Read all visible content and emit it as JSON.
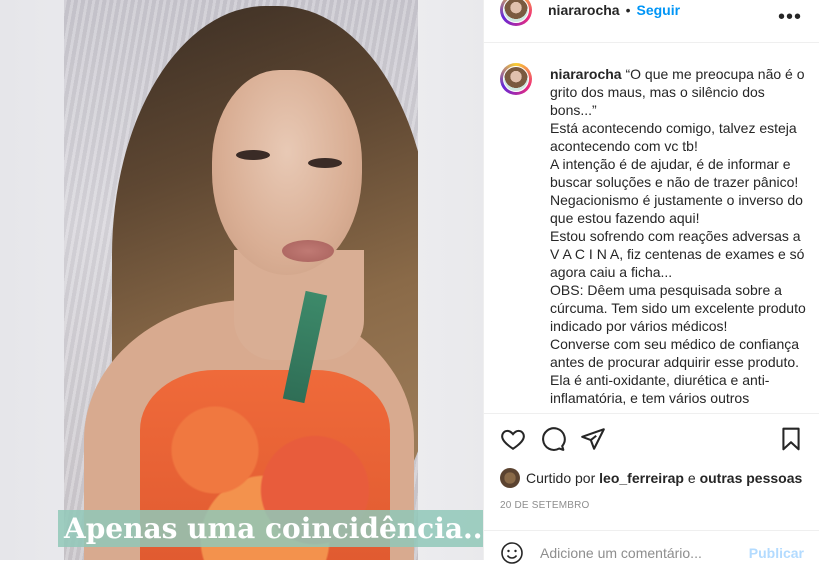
{
  "media": {
    "overlay_text": "Apenas uma coincidência..."
  },
  "header": {
    "username": "niararocha",
    "separator": "•",
    "follow_label": "Seguir",
    "more_label": "•••"
  },
  "caption": {
    "username": "niararocha",
    "lines": [
      "“O que me preocupa não é o grito dos maus, mas o silêncio dos bons...”",
      "Está acontecendo comigo, talvez esteja acontecendo com vc tb!",
      "A intenção é de ajudar, é de informar e buscar soluções e não de trazer pânico!",
      "Negacionismo é justamente o inverso do que estou fazendo aqui!",
      "Estou sofrendo com reações adversas a V A C I N A, fiz centenas de exames e só agora caiu a ficha...",
      "OBS: Dêem uma pesquisada sobre a cúrcuma. Tem sido um excelente produto indicado por vários médicos!",
      "Converse com seu médico de confiança antes de procurar adquirir esse produto.",
      "Ela é anti-oxidante, diurética e anti-inflamatória, e tem vários outros"
    ]
  },
  "icons": {
    "like": "heart-icon",
    "comment": "comment-icon",
    "share": "share-icon",
    "save": "bookmark-icon",
    "emoji": "emoji-icon"
  },
  "likes": {
    "prefix": "Curtido por",
    "user": "leo_ferreirap",
    "joiner": "e",
    "others": "outras pessoas"
  },
  "date": "20 DE SETEMBRO",
  "comment_box": {
    "placeholder": "Adicione um comentário...",
    "publish_label": "Publicar"
  },
  "colors": {
    "accent": "#0095f6",
    "publish_disabled": "#b3dbff",
    "overlay_bg": "#90c8b8"
  }
}
